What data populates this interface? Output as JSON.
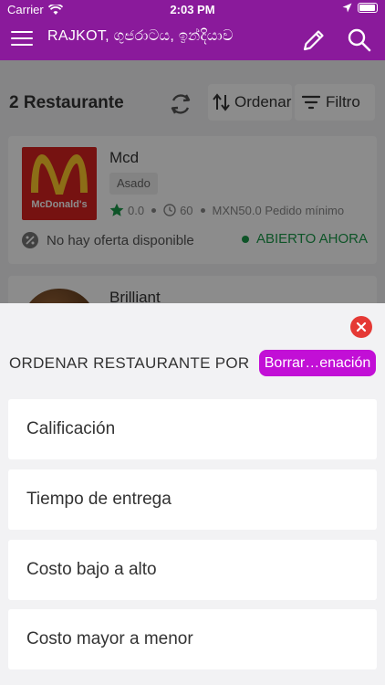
{
  "status_bar": {
    "carrier": "Carrier",
    "time": "2:03 PM"
  },
  "nav": {
    "location": "RAJKOT, ගුජරාටය, ඉන්දියාව",
    "icons": [
      "menu-icon",
      "edit-icon",
      "search-icon"
    ]
  },
  "list": {
    "count_label": "2 Restaurante",
    "sort_label": "Ordenar",
    "filter_label": "Filtro"
  },
  "restaurants": [
    {
      "name": "Mcd",
      "logo_text": "McDonald's",
      "tag": "Asado",
      "rating": "0.0",
      "time": "60",
      "min_order": "MXN50.0 Pedido mínimo",
      "offer": "No hay oferta disponible",
      "status": "ABIERTO AHORA"
    },
    {
      "name": "Brilliant"
    }
  ],
  "sheet": {
    "title": "ORDENAR RESTAURANTE POR",
    "clear_label": "Borrar…enación",
    "options": [
      "Calificación",
      "Tiempo de entrega",
      "Costo bajo a alto",
      "Costo mayor a menor"
    ]
  },
  "colors": {
    "brand_purple": "#8a1a9b",
    "clear_button": "#c20fd6",
    "close_red": "#e53935",
    "open_green": "#1a9a4a",
    "rating_green": "#1a9a4a"
  }
}
